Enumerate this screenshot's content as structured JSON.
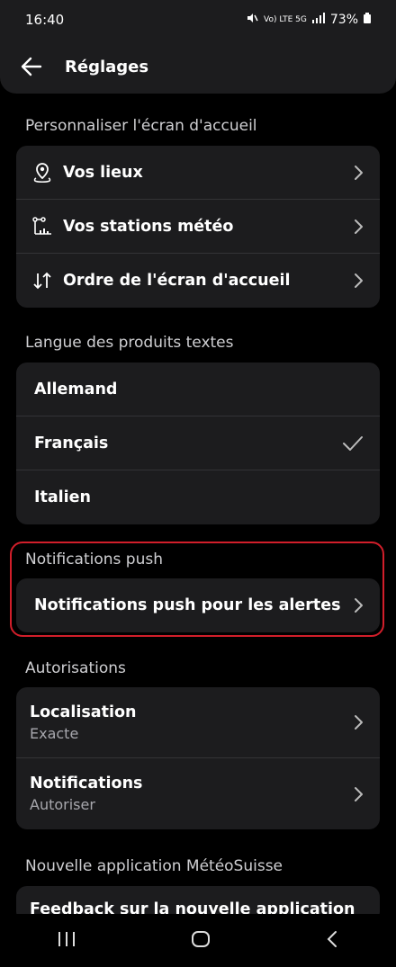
{
  "status": {
    "time": "16:40",
    "signal": "Vo) LTE 5G",
    "battery": "73%"
  },
  "header": {
    "title": "Réglages"
  },
  "sections": {
    "home": {
      "title": "Personnaliser l'écran d'accueil",
      "items": [
        {
          "label": "Vos lieux",
          "icon": "location-pin-icon"
        },
        {
          "label": "Vos stations météo",
          "icon": "weather-station-icon"
        },
        {
          "label": "Ordre de l'écran d'accueil",
          "icon": "sort-arrows-icon"
        }
      ]
    },
    "lang": {
      "title": "Langue des produits textes",
      "items": [
        {
          "label": "Allemand",
          "selected": false
        },
        {
          "label": "Français",
          "selected": true
        },
        {
          "label": "Italien",
          "selected": false
        }
      ]
    },
    "push": {
      "title": "Notifications push",
      "items": [
        {
          "label": "Notifications push pour les alertes"
        }
      ]
    },
    "auth": {
      "title": "Autorisations",
      "items": [
        {
          "label": "Localisation",
          "value": "Exacte"
        },
        {
          "label": "Notifications",
          "value": "Autoriser"
        }
      ]
    },
    "newapp": {
      "title": "Nouvelle application MétéoSuisse",
      "items": [
        {
          "label": "Feedback sur la nouvelle application"
        }
      ]
    }
  },
  "colors": {
    "accent": "#d11e2a",
    "card": "#1c1c1e",
    "background": "#000000"
  }
}
